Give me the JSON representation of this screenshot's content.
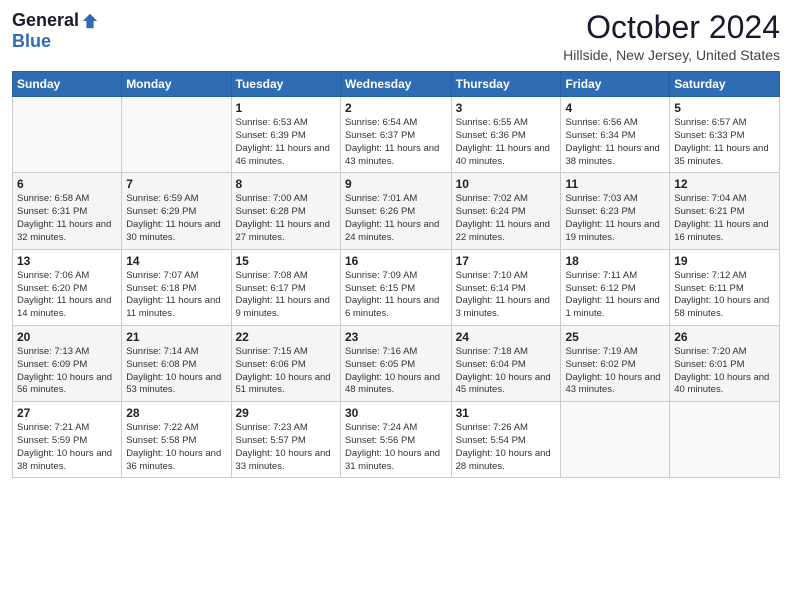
{
  "logo": {
    "general": "General",
    "blue": "Blue"
  },
  "title": "October 2024",
  "location": "Hillside, New Jersey, United States",
  "weekdays": [
    "Sunday",
    "Monday",
    "Tuesday",
    "Wednesday",
    "Thursday",
    "Friday",
    "Saturday"
  ],
  "weeks": [
    [
      {
        "day": "",
        "info": ""
      },
      {
        "day": "",
        "info": ""
      },
      {
        "day": "1",
        "info": "Sunrise: 6:53 AM\nSunset: 6:39 PM\nDaylight: 11 hours and 46 minutes."
      },
      {
        "day": "2",
        "info": "Sunrise: 6:54 AM\nSunset: 6:37 PM\nDaylight: 11 hours and 43 minutes."
      },
      {
        "day": "3",
        "info": "Sunrise: 6:55 AM\nSunset: 6:36 PM\nDaylight: 11 hours and 40 minutes."
      },
      {
        "day": "4",
        "info": "Sunrise: 6:56 AM\nSunset: 6:34 PM\nDaylight: 11 hours and 38 minutes."
      },
      {
        "day": "5",
        "info": "Sunrise: 6:57 AM\nSunset: 6:33 PM\nDaylight: 11 hours and 35 minutes."
      }
    ],
    [
      {
        "day": "6",
        "info": "Sunrise: 6:58 AM\nSunset: 6:31 PM\nDaylight: 11 hours and 32 minutes."
      },
      {
        "day": "7",
        "info": "Sunrise: 6:59 AM\nSunset: 6:29 PM\nDaylight: 11 hours and 30 minutes."
      },
      {
        "day": "8",
        "info": "Sunrise: 7:00 AM\nSunset: 6:28 PM\nDaylight: 11 hours and 27 minutes."
      },
      {
        "day": "9",
        "info": "Sunrise: 7:01 AM\nSunset: 6:26 PM\nDaylight: 11 hours and 24 minutes."
      },
      {
        "day": "10",
        "info": "Sunrise: 7:02 AM\nSunset: 6:24 PM\nDaylight: 11 hours and 22 minutes."
      },
      {
        "day": "11",
        "info": "Sunrise: 7:03 AM\nSunset: 6:23 PM\nDaylight: 11 hours and 19 minutes."
      },
      {
        "day": "12",
        "info": "Sunrise: 7:04 AM\nSunset: 6:21 PM\nDaylight: 11 hours and 16 minutes."
      }
    ],
    [
      {
        "day": "13",
        "info": "Sunrise: 7:06 AM\nSunset: 6:20 PM\nDaylight: 11 hours and 14 minutes."
      },
      {
        "day": "14",
        "info": "Sunrise: 7:07 AM\nSunset: 6:18 PM\nDaylight: 11 hours and 11 minutes."
      },
      {
        "day": "15",
        "info": "Sunrise: 7:08 AM\nSunset: 6:17 PM\nDaylight: 11 hours and 9 minutes."
      },
      {
        "day": "16",
        "info": "Sunrise: 7:09 AM\nSunset: 6:15 PM\nDaylight: 11 hours and 6 minutes."
      },
      {
        "day": "17",
        "info": "Sunrise: 7:10 AM\nSunset: 6:14 PM\nDaylight: 11 hours and 3 minutes."
      },
      {
        "day": "18",
        "info": "Sunrise: 7:11 AM\nSunset: 6:12 PM\nDaylight: 11 hours and 1 minute."
      },
      {
        "day": "19",
        "info": "Sunrise: 7:12 AM\nSunset: 6:11 PM\nDaylight: 10 hours and 58 minutes."
      }
    ],
    [
      {
        "day": "20",
        "info": "Sunrise: 7:13 AM\nSunset: 6:09 PM\nDaylight: 10 hours and 56 minutes."
      },
      {
        "day": "21",
        "info": "Sunrise: 7:14 AM\nSunset: 6:08 PM\nDaylight: 10 hours and 53 minutes."
      },
      {
        "day": "22",
        "info": "Sunrise: 7:15 AM\nSunset: 6:06 PM\nDaylight: 10 hours and 51 minutes."
      },
      {
        "day": "23",
        "info": "Sunrise: 7:16 AM\nSunset: 6:05 PM\nDaylight: 10 hours and 48 minutes."
      },
      {
        "day": "24",
        "info": "Sunrise: 7:18 AM\nSunset: 6:04 PM\nDaylight: 10 hours and 45 minutes."
      },
      {
        "day": "25",
        "info": "Sunrise: 7:19 AM\nSunset: 6:02 PM\nDaylight: 10 hours and 43 minutes."
      },
      {
        "day": "26",
        "info": "Sunrise: 7:20 AM\nSunset: 6:01 PM\nDaylight: 10 hours and 40 minutes."
      }
    ],
    [
      {
        "day": "27",
        "info": "Sunrise: 7:21 AM\nSunset: 5:59 PM\nDaylight: 10 hours and 38 minutes."
      },
      {
        "day": "28",
        "info": "Sunrise: 7:22 AM\nSunset: 5:58 PM\nDaylight: 10 hours and 36 minutes."
      },
      {
        "day": "29",
        "info": "Sunrise: 7:23 AM\nSunset: 5:57 PM\nDaylight: 10 hours and 33 minutes."
      },
      {
        "day": "30",
        "info": "Sunrise: 7:24 AM\nSunset: 5:56 PM\nDaylight: 10 hours and 31 minutes."
      },
      {
        "day": "31",
        "info": "Sunrise: 7:26 AM\nSunset: 5:54 PM\nDaylight: 10 hours and 28 minutes."
      },
      {
        "day": "",
        "info": ""
      },
      {
        "day": "",
        "info": ""
      }
    ]
  ]
}
